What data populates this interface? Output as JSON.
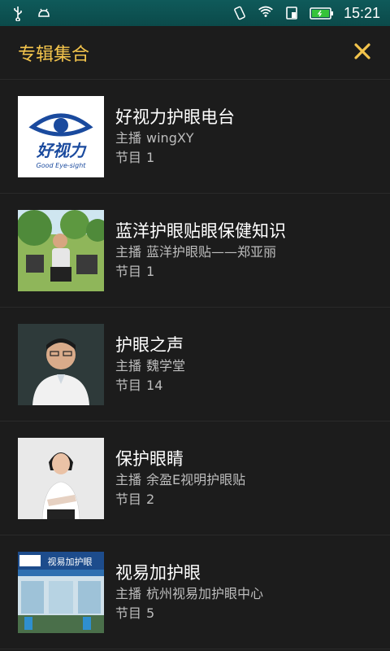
{
  "status_bar": {
    "time": "15:21"
  },
  "header": {
    "title": "专辑集合"
  },
  "host_label": "主播",
  "count_label": "节目",
  "items": [
    {
      "title": "好视力护眼电台",
      "host": "wingXY",
      "count": "1",
      "logo_text": "好视力",
      "logo_sub": "Good Eye-sight"
    },
    {
      "title": "蓝洋护眼贴眼保健知识",
      "host": "蓝洋护眼贴——郑亚丽",
      "count": "1"
    },
    {
      "title": "护眼之声",
      "host": "魏学堂",
      "count": "14"
    },
    {
      "title": "保护眼睛",
      "host": "余盈E视明护眼贴",
      "count": "2"
    },
    {
      "title": "视易加护眼",
      "host": "杭州视易加护眼中心",
      "count": "5",
      "sign_text": "视易加护眼"
    }
  ],
  "colors": {
    "accent": "#f3c44c",
    "background": "#1c1c1c",
    "status_bar": "#0f5a5a"
  }
}
